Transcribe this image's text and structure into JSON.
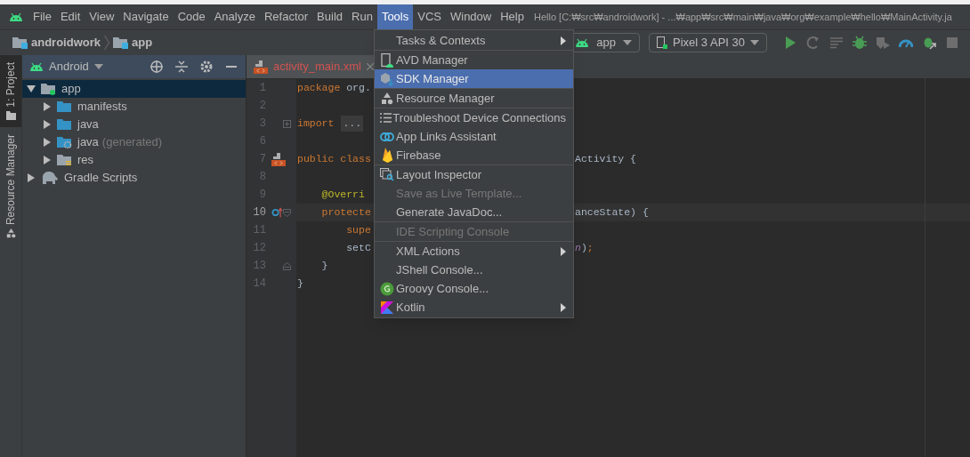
{
  "menu_bar": {
    "items": [
      {
        "label": "File",
        "selected": false
      },
      {
        "label": "Edit",
        "selected": false
      },
      {
        "label": "View",
        "selected": false
      },
      {
        "label": "Navigate",
        "selected": false
      },
      {
        "label": "Code",
        "selected": false
      },
      {
        "label": "Analyze",
        "selected": false
      },
      {
        "label": "Refactor",
        "selected": false
      },
      {
        "label": "Build",
        "selected": false
      },
      {
        "label": "Run",
        "selected": false
      },
      {
        "label": "Tools",
        "selected": true
      },
      {
        "label": "VCS",
        "selected": false
      },
      {
        "label": "Window",
        "selected": false
      },
      {
        "label": "Help",
        "selected": false
      }
    ],
    "title": "Hello [C:₩src₩androidwork] - ...₩app₩src₩main₩java₩org₩example₩hello₩MainActivity.ja"
  },
  "breadcrumbs": [
    "androidwork",
    "app"
  ],
  "toolbar": {
    "run_config": "app",
    "device": "Pixel 3 API 30"
  },
  "side_tabs": [
    {
      "label": "1: Project",
      "selected": true
    },
    {
      "label": "Resource Manager",
      "selected": false
    }
  ],
  "project_panel": {
    "view": "Android",
    "tree": [
      {
        "label": "app",
        "selected": true,
        "expanded": true,
        "children": [
          {
            "label": "manifests",
            "selected": false,
            "expanded": false
          },
          {
            "label": "java",
            "selected": false,
            "expanded": false
          },
          {
            "label": "java",
            "note": "(generated)",
            "selected": false,
            "expanded": false
          },
          {
            "label": "res",
            "selected": false,
            "expanded": false
          }
        ]
      },
      {
        "label": "Gradle Scripts",
        "selected": false,
        "expanded": false
      }
    ]
  },
  "editor": {
    "tabs": [
      {
        "label": "activity_main.xml",
        "selected": true
      }
    ],
    "lines": [
      {
        "number": "1",
        "left": [
          {
            "text": "package",
            "kind": "keyword"
          },
          {
            "text": " org.",
            "kind": "plain"
          }
        ]
      },
      {
        "number": "2"
      },
      {
        "number": "3",
        "left": [
          {
            "text": "import",
            "kind": "keyword"
          },
          {
            "text": "...",
            "kind": "fold"
          }
        ],
        "gutter_icons": [
          {
            "kind": "fold_closed"
          }
        ]
      },
      {
        "number": "6"
      },
      {
        "number": "7",
        "left": [
          {
            "text": "public class",
            "kind": "keyword"
          }
        ],
        "right": [
          {
            "text": "Activity {",
            "kind": "plain"
          }
        ],
        "gutter_icons": [
          {
            "kind": "layout"
          }
        ]
      },
      {
        "number": "8"
      },
      {
        "number": "9",
        "left": [
          {
            "text": "    @Overri",
            "kind": "annotation"
          }
        ]
      },
      {
        "number": "10",
        "left": [
          {
            "text": "    protecte",
            "kind": "keyword"
          }
        ],
        "right": [
          {
            "text": "anceState) {",
            "kind": "plain"
          }
        ],
        "gutter_icons": [
          {
            "kind": "override"
          },
          {
            "kind": "fold_start"
          }
        ],
        "current": true
      },
      {
        "number": "11",
        "left": [
          {
            "text": "        supe",
            "kind": "keyword"
          }
        ]
      },
      {
        "number": "12",
        "left": [
          {
            "text": "        setC",
            "kind": "plain"
          }
        ],
        "right": [
          {
            "text": "n",
            "kind": "field"
          },
          {
            "text": ")",
            "kind": "plain"
          },
          {
            "text": ";",
            "kind": "keyword"
          }
        ]
      },
      {
        "number": "13",
        "left": [
          {
            "text": "    }",
            "kind": "plain"
          }
        ],
        "gutter_icons": [
          {
            "kind": "fold_end"
          }
        ]
      },
      {
        "number": "14",
        "left": [
          {
            "text": "}",
            "kind": "plain"
          }
        ]
      }
    ]
  },
  "tools_menu": {
    "groups": [
      [
        {
          "label": "Tasks & Contexts",
          "submenu": true,
          "selected": false,
          "disabled": false
        }
      ],
      [
        {
          "label": "AVD Manager",
          "selected": false,
          "disabled": false
        },
        {
          "label": "SDK Manager",
          "selected": true,
          "disabled": false
        }
      ],
      [
        {
          "label": "Resource Manager",
          "selected": false,
          "disabled": false
        }
      ],
      [
        {
          "label": "Troubleshoot Device Connections",
          "selected": false,
          "disabled": false
        },
        {
          "label": "App Links Assistant",
          "selected": false,
          "disabled": false
        },
        {
          "label": "Firebase",
          "selected": false,
          "disabled": false
        }
      ],
      [
        {
          "label": "Layout Inspector",
          "selected": false,
          "disabled": false
        },
        {
          "label": "Save as Live Template...",
          "selected": false,
          "disabled": true
        },
        {
          "label": "Generate JavaDoc...",
          "selected": false,
          "disabled": false
        }
      ],
      [
        {
          "label": "IDE Scripting Console",
          "selected": false,
          "disabled": true
        }
      ],
      [
        {
          "label": "XML Actions",
          "submenu": true,
          "selected": false,
          "disabled": false
        },
        {
          "label": "JShell Console...",
          "selected": false,
          "disabled": false
        },
        {
          "label": "Groovy Console...",
          "selected": false,
          "disabled": false
        },
        {
          "label": "Kotlin",
          "submenu": true,
          "selected": false,
          "disabled": false
        }
      ]
    ]
  }
}
